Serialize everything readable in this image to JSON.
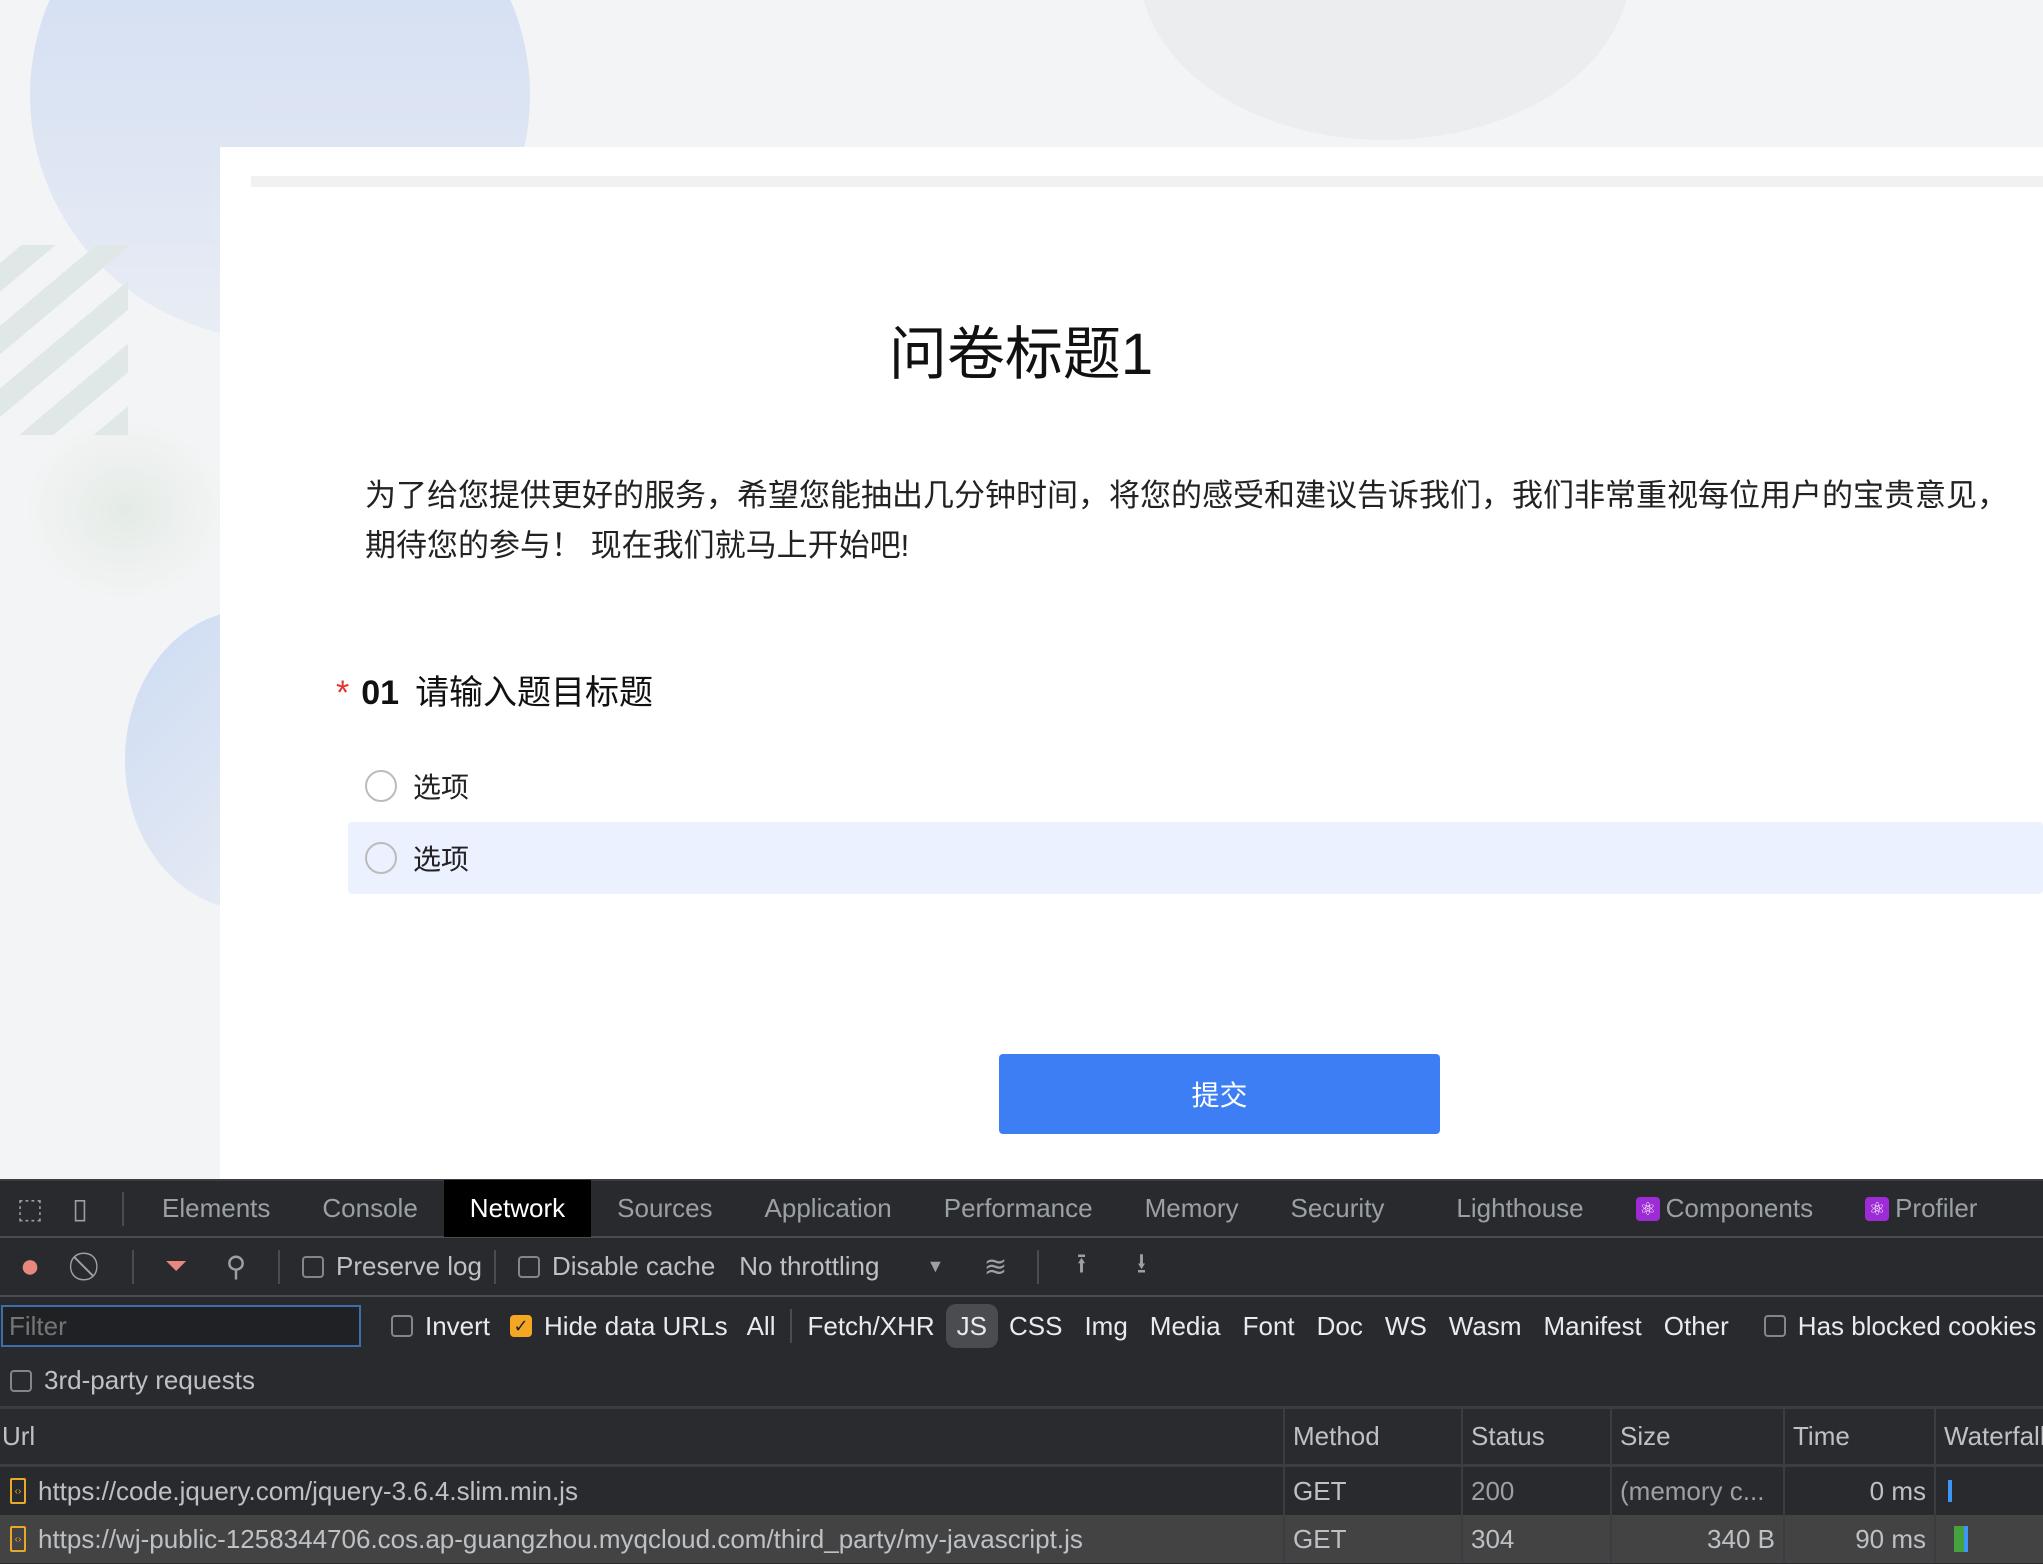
{
  "survey": {
    "title": "问卷标题1",
    "description_line1": "为了给您提供更好的服务，希望您能抽出几分钟时间，将您的感受和建议告诉我们，我们非常重视每位用户的宝贵意见，",
    "description_line2": "期待您的参与！ 现在我们就马上开始吧!",
    "question": {
      "required_mark": "*",
      "number": "01",
      "title": "请输入题目标题",
      "options": [
        "选项",
        "选项"
      ]
    },
    "submit_label": "提交",
    "colors": {
      "primary": "#3d7ef5",
      "highlight": "#ebf1fe",
      "required": "#e5322d"
    }
  },
  "devtools": {
    "tabs": [
      "Elements",
      "Console",
      "Network",
      "Sources",
      "Application",
      "Performance",
      "Memory",
      "Security",
      "Lighthouse",
      "Components",
      "Profiler"
    ],
    "active_tab": "Network",
    "toolbar": {
      "preserve_log": "Preserve log",
      "disable_cache": "Disable cache",
      "throttling": "No throttling"
    },
    "filter": {
      "placeholder": "Filter",
      "invert": "Invert",
      "hide_data_urls": "Hide data URLs",
      "hide_data_urls_checked": true,
      "types": [
        "All",
        "Fetch/XHR",
        "JS",
        "CSS",
        "Img",
        "Media",
        "Font",
        "Doc",
        "WS",
        "Wasm",
        "Manifest",
        "Other"
      ],
      "selected_type": "JS",
      "has_blocked_cookies": "Has blocked cookies",
      "third_party": "3rd-party requests"
    },
    "columns": [
      "Url",
      "Method",
      "Status",
      "Size",
      "Time",
      "Waterfall"
    ],
    "requests": [
      {
        "url": "https://code.jquery.com/jquery-3.6.4.slim.min.js",
        "method": "GET",
        "status": "200",
        "size": "(memory c...",
        "time": "0 ms"
      },
      {
        "url": "https://wj-public-1258344706.cos.ap-guangzhou.myqcloud.com/third_party/my-javascript.js",
        "method": "GET",
        "status": "304",
        "size": "340 B",
        "time": "90 ms"
      }
    ]
  }
}
